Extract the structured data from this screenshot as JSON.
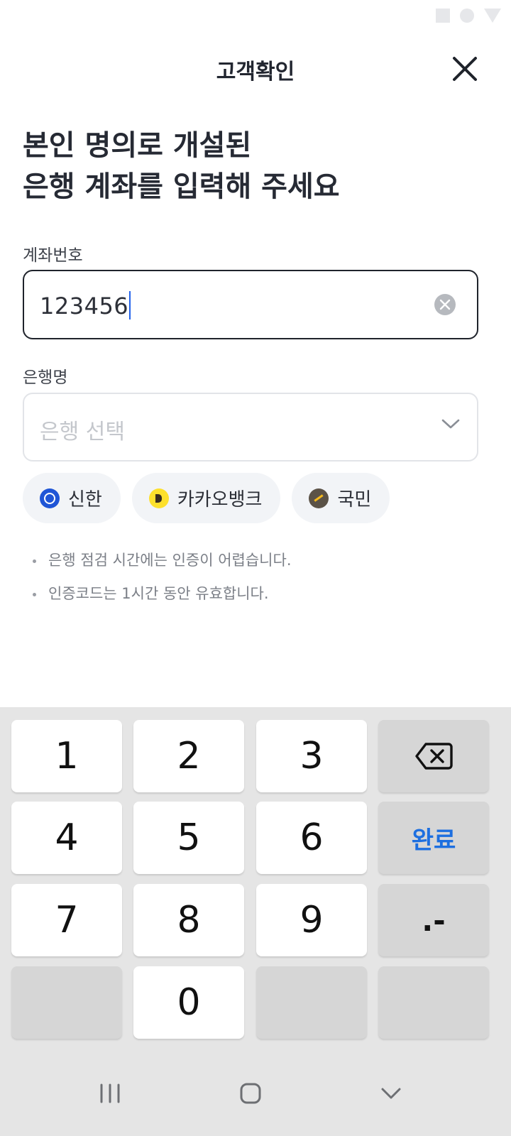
{
  "header": {
    "title": "고객확인"
  },
  "headline": {
    "line1": "본인 명의로 개설된",
    "line2": "은행 계좌를 입력해 주세요"
  },
  "account": {
    "label": "계좌번호",
    "value": "123456"
  },
  "bank": {
    "label": "은행명",
    "placeholder": "은행 선택"
  },
  "quick_banks": [
    {
      "label": "신한",
      "color": "#1f55d6"
    },
    {
      "label": "카카오뱅크",
      "color": "#fde02c"
    },
    {
      "label": "국민",
      "color": "#5b5247"
    }
  ],
  "notes": [
    "은행 점검 시간에는 인증이 어렵습니다.",
    "인증코드는 1시간 동안 유효합니다."
  ],
  "keypad": {
    "k1": "1",
    "k2": "2",
    "k3": "3",
    "k4": "4",
    "k5": "5",
    "k6": "6",
    "k7": "7",
    "k8": "8",
    "k9": "9",
    "k0": "0",
    "done": "완료",
    "dot_dash": ".-",
    "backspace_icon": "backspace-icon"
  },
  "colors": {
    "accent": "#1d6fe0",
    "caret": "#2463eb",
    "keypad_bg": "#e5e5e5"
  }
}
